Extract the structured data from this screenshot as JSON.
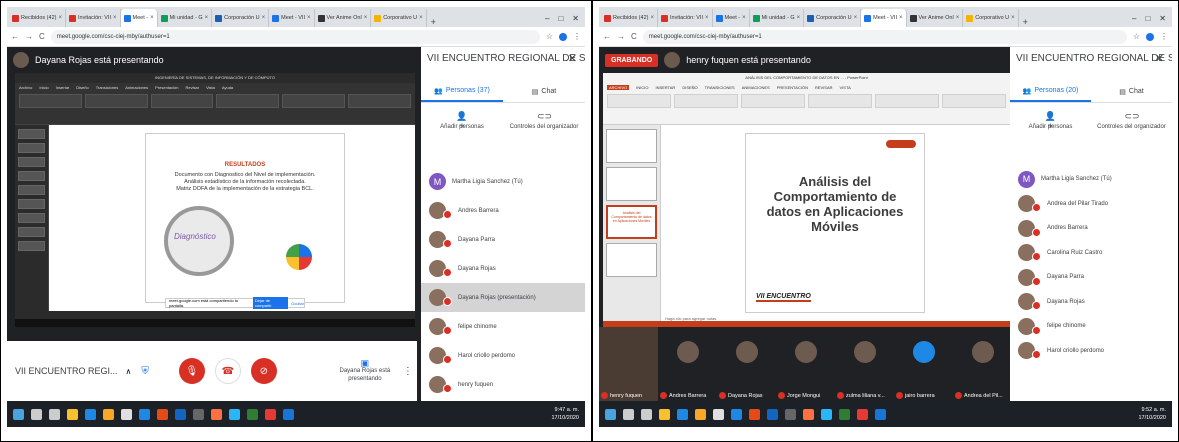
{
  "left": {
    "tabs": [
      {
        "label": "Recibidos (42)",
        "color": "#d93025"
      },
      {
        "label": "Invitación: VII",
        "color": "#d93025"
      },
      {
        "label": "Meet - ",
        "color": "#1a73e8",
        "active": true
      },
      {
        "label": "Mi unidad - G",
        "color": "#0f9d58"
      },
      {
        "label": "Corporación U",
        "color": "#1a5fb4"
      },
      {
        "label": "Meet - VII",
        "color": "#1a73e8"
      },
      {
        "label": "Ver Anime Onl",
        "color": "#333333"
      },
      {
        "label": "Corporativo U",
        "color": "#f4b400"
      }
    ],
    "url": "meet.google.com/csc-ciej-mby/authuser=1",
    "presenter_banner": "Dayana Rojas está presentando",
    "ppt_title": "INGENIERÍA DE SISTEMAS, DE INFORMACIÓN Y DE CÓMPUTO",
    "slide_title": "RESULTADOS",
    "slide_lines": [
      "Documento con Diagnostico del Nivel de implementación.",
      "Análisis estadístico de la información recolectada.",
      "Matriz DOFA de la implementación de la estrategia BCL."
    ],
    "diag_word": "Diagnóstico",
    "share_notice": "meet.google.com está compartiendo tu pantalla.",
    "share_stop": "Dejar de compartir",
    "share_hide": "Ocultar",
    "meeting_name": "VII ENCUENTRO REGI...",
    "present_label": "Dayana Rojas está presentando",
    "side_title": "VII ENCUENTRO REGIONAL DE S...",
    "people_tab": "Personas (37)",
    "chat_tab": "Chat",
    "add_people": "Añadir personas",
    "host_controls": "Controles del organizador",
    "participants": [
      "Martha Ligia Sanchez (Tú)",
      "Andres Barrera",
      "Dayana Parra",
      "Dayana Rojas",
      "Dayana Rojas (presentación)",
      "felipe chinome",
      "Harol criollo perdomo",
      "henry fuquen"
    ],
    "time": "9:47 a. m.",
    "date": "17/10/2020",
    "lang": "ESP"
  },
  "right": {
    "tabs": [
      {
        "label": "Recibidos (42)",
        "color": "#d93025"
      },
      {
        "label": "Invitación: VII",
        "color": "#d93025"
      },
      {
        "label": "Meet - ",
        "color": "#1a73e8"
      },
      {
        "label": "Mi unidad - G",
        "color": "#0f9d58"
      },
      {
        "label": "Corporación U",
        "color": "#1a5fb4"
      },
      {
        "label": "Meet - VII",
        "color": "#1a73e8",
        "active": true
      },
      {
        "label": "Ver Anime Onl",
        "color": "#333333"
      },
      {
        "label": "Corporativo U",
        "color": "#f4b400"
      }
    ],
    "url": "meet.google.com/csc-ciej-mby/authuser=1",
    "recording": "GRABANDO",
    "presenter_banner": "henry fuquen está presentando",
    "ppt_title": "ANÁLISIS DEL COMPORTAMIENTO DE DATOS EN ... - PowerPoint",
    "slide_title": "Análisis del Comportamiento de datos en Aplicaciones Móviles",
    "thumb_text": "Análisis del Comportamiento de datos en Aplicaciones Móviles",
    "notes_hint": "Haga clic para agregar notas",
    "event_logo": "VII ENCUENTRO",
    "side_title": "VII ENCUENTRO REGIONAL DE S...",
    "people_tab": "Personas (20)",
    "chat_tab": "Chat",
    "add_people": "Añadir personas",
    "host_controls": "Controles del organizador",
    "participants": [
      "Martha Ligia Sanchez (Tú)",
      "Andrea del Pilar Tirado",
      "Andres Barrera",
      "Carolina Ruiz Castro",
      "Dayana Parra",
      "Dayana Rojas",
      "felipe chinome",
      "Harol criollo perdomo"
    ],
    "video_tiles": [
      "henry fuquen",
      "Andres Barrera",
      "Dayana Rojas",
      "Jorge Mongui",
      "zulma liliana v...",
      "jairo barrera",
      "Andrea del Pil..."
    ],
    "time": "9:52 a. m.",
    "date": "17/10/2020",
    "lang": "ESP"
  }
}
